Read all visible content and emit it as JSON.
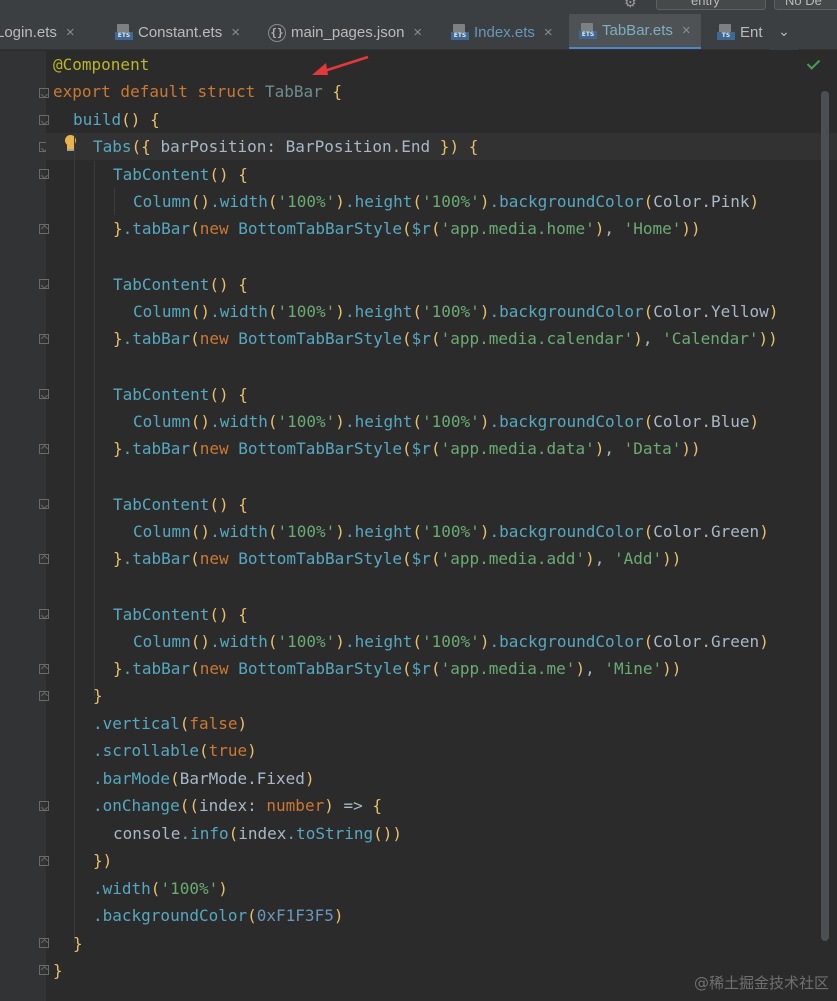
{
  "toolbar": {
    "gear_icon": "gear-icon",
    "module_select": "entry",
    "device_select": "No De"
  },
  "tabs": [
    {
      "label": "Login.ets",
      "icon": "ets",
      "close": "×"
    },
    {
      "label": "Constant.ets",
      "icon": "ets",
      "close": "×"
    },
    {
      "label": "main_pages.json",
      "icon": "json",
      "close": "×"
    },
    {
      "label": "Index.ets",
      "icon": "ets",
      "close": "×"
    },
    {
      "label": "TabBar.ets",
      "icon": "ets",
      "close": "×"
    },
    {
      "label": "Ent",
      "icon": "ts",
      "close": ""
    }
  ],
  "tab_dropdown": "⌄",
  "code": {
    "l1": {
      "dec": "@Component"
    },
    "l2": {
      "kw": "export default struct",
      "name": "TabBar",
      "brace": "{"
    },
    "l3": {
      "fn": "build",
      "paren": "()",
      "brace": "{"
    },
    "l4": {
      "fn": "Tabs",
      "p1": "(",
      "b1": "{",
      "prop": " barPosition: BarPosition.End ",
      "b2": "}",
      "p2": ")",
      "brace": "{"
    },
    "tab_contents": [
      {
        "open": "TabContent",
        "color": "Color.Pink",
        "res": "'app.media.home'",
        "label": "'Home'"
      },
      {
        "open": "TabContent",
        "color": "Color.Yellow",
        "res": "'app.media.calendar'",
        "label": "'Calendar'"
      },
      {
        "open": "TabContent",
        "color": "Color.Blue",
        "res": "'app.media.data'",
        "label": "'Data'"
      },
      {
        "open": "TabContent",
        "color": "Color.Green",
        "res": "'app.media.add'",
        "label": "'Add'"
      },
      {
        "open": "TabContent",
        "color": "Color.Green",
        "res": "'app.media.me'",
        "label": "'Mine'"
      }
    ],
    "column_call": "Column",
    "width_call": ".width",
    "height_call": ".height",
    "bg_call": ".backgroundColor",
    "pct": "'100%'",
    "tabbar_call": ".tabBar",
    "new_kw": "new",
    "style_class": "BottomTabBarStyle",
    "res_fn": "$r",
    "close_tabs": "}",
    "vertical": {
      "fn": ".vertical",
      "arg": "false"
    },
    "scrollable": {
      "fn": ".scrollable",
      "arg": "true"
    },
    "barmode": {
      "fn": ".barMode",
      "arg": "BarMode.Fixed"
    },
    "onchange": {
      "fn": ".onChange",
      "param": "index",
      "type": "number",
      "arrow": "=>"
    },
    "console": {
      "obj": "console",
      "fn": ".info",
      "arg": "index",
      "call": ".toString",
      "paren": "()"
    },
    "onchange_close": "})",
    "width": {
      "fn": ".width",
      "arg": "'100%'"
    },
    "bgcolor": {
      "fn": ".backgroundColor",
      "arg": "0xF1F3F5"
    },
    "close_build": "}",
    "close_struct": "}"
  },
  "status_check": "check-icon",
  "watermark": "@稀土掘金技术社区",
  "colors": {
    "background": "#2b2b2b",
    "gutter": "#313335",
    "keyword": "#cc7832",
    "string": "#6aab73",
    "function": "#56a8c0",
    "decorator": "#bbb529",
    "active_tab_underline": "#4a88c7",
    "annotation_arrow": "#e5383b"
  }
}
